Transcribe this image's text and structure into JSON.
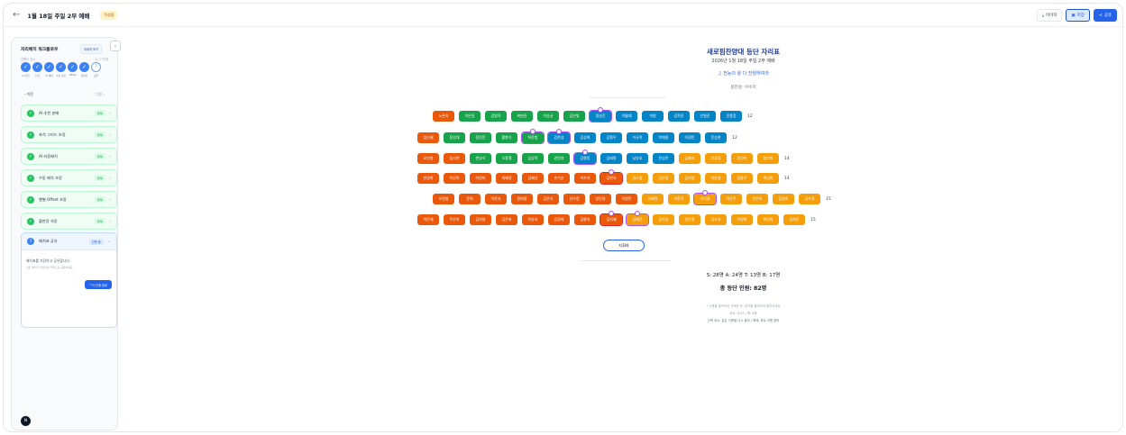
{
  "header": {
    "back_icon": "arrow-left-icon",
    "title": "1월 18일 주일 2부 예배",
    "badge": "작성중",
    "buttons": [
      {
        "label": "이미지",
        "icon": "download-icon"
      },
      {
        "label": "저장",
        "icon": "save-icon"
      },
      {
        "label": "공유",
        "icon": "share-icon"
      }
    ]
  },
  "sidebar": {
    "title": "자리배치 워크플로우",
    "tag": "자세히 보기",
    "progress_label": "진행도 표시",
    "progress_value": "5 / 7 단계",
    "steps": [
      {
        "label": "AI 추천",
        "done": true
      },
      {
        "label": "그리드",
        "done": true
      },
      {
        "label": "AI 배치",
        "done": true
      },
      {
        "label": "수동 조정",
        "done": true
      },
      {
        "label": "Offset",
        "done": true
      },
      {
        "label": "출판장",
        "done": true
      },
      {
        "label": "공유",
        "done": false,
        "num": "7"
      }
    ],
    "prev": "이전",
    "next": "다음",
    "items": [
      {
        "label": "AI 추천 분배",
        "status": "완료"
      },
      {
        "label": "좌석 그리드 조정",
        "status": "완료"
      },
      {
        "label": "AI 자동배치",
        "status": "완료"
      },
      {
        "label": "수동 배치 조정",
        "status": "완료"
      },
      {
        "label": "행별 Offset 조정",
        "status": "완료"
      },
      {
        "label": "출판장 저장",
        "status": "완료"
      }
    ],
    "active": {
      "num": "7",
      "label": "배치표 공유",
      "status": "진행 중",
      "desc": "배치표를 저장하고 공유합니다.",
      "sub": "모든 배치가 저장되면 카톡으로 공유하세요.",
      "button": "이 단계 완료"
    },
    "avatar": "N"
  },
  "main": {
    "title": "새로핌찬양대 등단 자리표",
    "date": "2026년 1월 18일 주일 2부 예배",
    "song": "♫ 전능의 왕 다 찬양하여라",
    "leader": "봉헌송: 이수지",
    "rows": [
      {
        "count": "12",
        "seats": [
          {
            "name": "노은숙",
            "p": "S"
          },
          {
            "name": "이은동",
            "p": "A"
          },
          {
            "name": "김명옥",
            "p": "A"
          },
          {
            "name": "최현준",
            "p": "A"
          },
          {
            "name": "이승균",
            "p": "A"
          },
          {
            "name": "김은빛",
            "p": "A"
          },
          {
            "name": "정성진",
            "p": "T",
            "heart": true
          },
          {
            "name": "이월재",
            "p": "T"
          },
          {
            "name": "허원",
            "p": "T"
          },
          {
            "name": "김학준",
            "p": "T"
          },
          {
            "name": "안필준",
            "p": "T"
          },
          {
            "name": "윤종훈",
            "p": "T"
          }
        ]
      },
      {
        "count": "12",
        "seats": [
          {
            "name": "임신혜",
            "p": "S"
          },
          {
            "name": "장성대",
            "p": "A"
          },
          {
            "name": "정진문",
            "p": "A"
          },
          {
            "name": "황향식",
            "p": "A"
          },
          {
            "name": "허윤범",
            "p": "A",
            "heart": true
          },
          {
            "name": "김한섭",
            "p": "T",
            "heart": true
          },
          {
            "name": "김성희",
            "p": "T"
          },
          {
            "name": "김철우",
            "p": "T"
          },
          {
            "name": "이규락",
            "p": "T"
          },
          {
            "name": "박재용",
            "p": "T"
          },
          {
            "name": "이경민",
            "p": "T"
          },
          {
            "name": "윤승현",
            "p": "T"
          }
        ]
      },
      {
        "count": "14",
        "seats": [
          {
            "name": "오신영",
            "p": "S"
          },
          {
            "name": "임서연",
            "p": "S"
          },
          {
            "name": "변성식",
            "p": "A"
          },
          {
            "name": "오흥철",
            "p": "A"
          },
          {
            "name": "김상목",
            "p": "A"
          },
          {
            "name": "권민영",
            "p": "A"
          },
          {
            "name": "김향동",
            "p": "T",
            "heart": true
          },
          {
            "name": "김태명",
            "p": "T"
          },
          {
            "name": "남승호",
            "p": "T"
          },
          {
            "name": "전성진",
            "p": "T"
          },
          {
            "name": "김혜숙",
            "p": "B"
          },
          {
            "name": "민경실",
            "p": "B"
          },
          {
            "name": "전신미",
            "p": "B"
          },
          {
            "name": "황선미",
            "p": "B"
          }
        ]
      },
      {
        "count": "14",
        "seats": [
          {
            "name": "한성희",
            "p": "S"
          },
          {
            "name": "이선아",
            "p": "S"
          },
          {
            "name": "이선미",
            "p": "S"
          },
          {
            "name": "최혜경",
            "p": "S"
          },
          {
            "name": "김혜선",
            "p": "S"
          },
          {
            "name": "손기순",
            "p": "S"
          },
          {
            "name": "이수지",
            "p": "S"
          },
          {
            "name": "김현숙",
            "p": "S",
            "heart": true,
            "red": true
          },
          {
            "name": "권소정",
            "p": "B"
          },
          {
            "name": "김은정",
            "p": "B"
          },
          {
            "name": "김지영",
            "p": "B"
          },
          {
            "name": "최순영",
            "p": "B"
          },
          {
            "name": "임용수",
            "p": "B"
          },
          {
            "name": "백성민",
            "p": "B"
          }
        ]
      },
      {
        "count": "15",
        "seats": [
          {
            "name": "오연봉",
            "p": "S"
          },
          {
            "name": "문희",
            "p": "S"
          },
          {
            "name": "이윤숙",
            "p": "S"
          },
          {
            "name": "원희정",
            "p": "S"
          },
          {
            "name": "김은식",
            "p": "S"
          },
          {
            "name": "신수정",
            "p": "S"
          },
          {
            "name": "방인영",
            "p": "S"
          },
          {
            "name": "이영란",
            "p": "S"
          },
          {
            "name": "이혜련",
            "p": "B"
          },
          {
            "name": "이윤옥",
            "p": "B"
          },
          {
            "name": "이지영",
            "p": "B",
            "heart": true
          },
          {
            "name": "이은주",
            "p": "B"
          },
          {
            "name": "안은희",
            "p": "B"
          },
          {
            "name": "김영희",
            "p": "B"
          },
          {
            "name": "김수정",
            "p": "B"
          }
        ]
      },
      {
        "count": "15",
        "seats": [
          {
            "name": "이은혜",
            "p": "S"
          },
          {
            "name": "주은미",
            "p": "S"
          },
          {
            "name": "김지영",
            "p": "S"
          },
          {
            "name": "김은희",
            "p": "S"
          },
          {
            "name": "이승숙",
            "p": "S"
          },
          {
            "name": "김정희",
            "p": "S"
          },
          {
            "name": "김향숙",
            "p": "S"
          },
          {
            "name": "김지혜",
            "p": "S",
            "heart": true,
            "red": true
          },
          {
            "name": "김혜진",
            "p": "B",
            "heart": true
          },
          {
            "name": "김지숙",
            "p": "B"
          },
          {
            "name": "민은홍",
            "p": "B"
          },
          {
            "name": "김소숙",
            "p": "B"
          },
          {
            "name": "이정희",
            "p": "B"
          },
          {
            "name": "최인희",
            "p": "B"
          },
          {
            "name": "김희진",
            "p": "B"
          }
        ]
      }
    ],
    "conductor": "지휘자",
    "stats": "S: 28명   A: 24명   T: 13명   B: 17명",
    "total": "총 등단 인원: 82명",
    "note1": "* 이름을 클릭하여 선택한 후, 위치를 클릭하여 배치하세요",
    "note2": "파트: 8/29 | 행: 6행",
    "note3": "선택 취소: 같은 이름을 다시 클릭 | 해제: 파트 이름 클릭"
  },
  "colors": {
    "S": "#ea580c",
    "A": "#16a34a",
    "T": "#0284c7",
    "B": "#f59e0b",
    "accent": "#2563eb"
  }
}
